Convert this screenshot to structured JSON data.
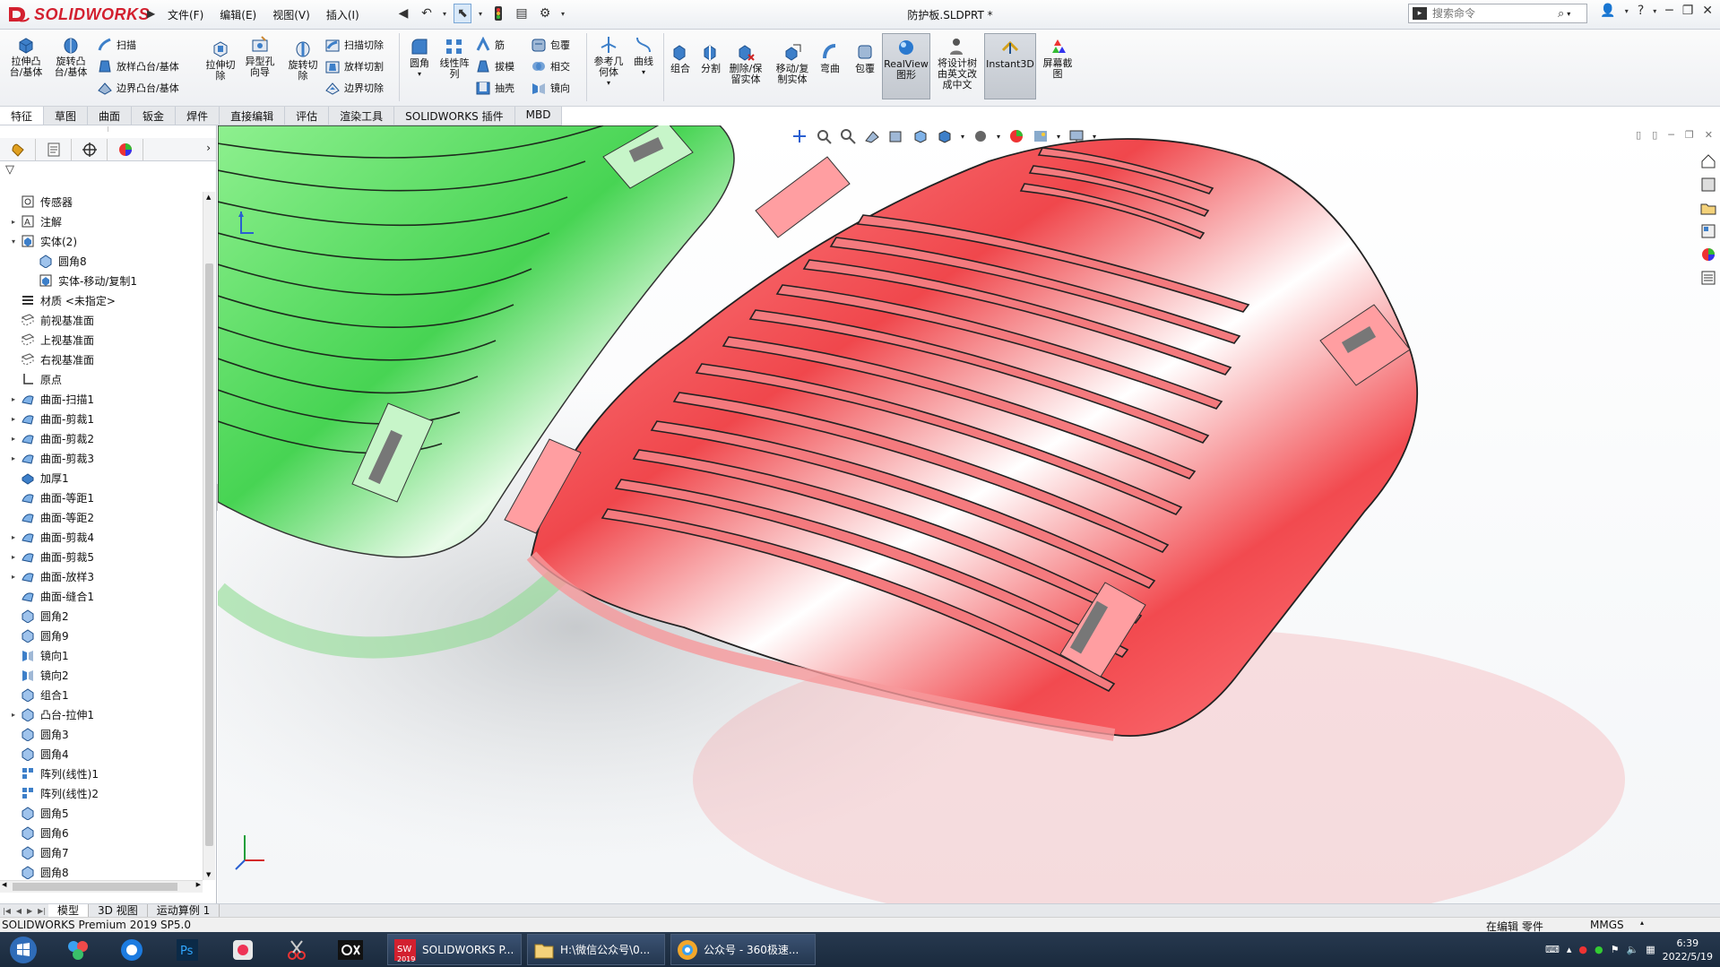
{
  "app": {
    "brand": "SOLIDWORKS",
    "document_title": "防护板.SLDPRT *"
  },
  "menu": [
    "文件(F)",
    "编辑(E)",
    "视图(V)",
    "插入(I)"
  ],
  "search": {
    "placeholder": "搜索命令"
  },
  "ribbon": {
    "extrude_boss": "拉伸凸\n台/基体",
    "revolve_boss": "旋转凸\n台/基体",
    "sweep": "扫描",
    "loft": "放样凸台/基体",
    "boundary_boss": "边界凸台/基体",
    "extrude_cut": "拉伸切\n除",
    "hole_wizard": "异型孔\n向导",
    "revolve_cut": "旋转切\n除",
    "swept_cut": "扫描切除",
    "lofted_cut": "放样切割",
    "boundary_cut": "边界切除",
    "fillet": "圆角",
    "linear_pattern": "线性阵\n列",
    "rib": "筋",
    "draft": "拔模",
    "shell": "抽壳",
    "wrap": "包覆",
    "intersect": "相交",
    "mirror": "镜向",
    "ref_geometry": "参考几\n何体",
    "curves": "曲线",
    "combine": "组合",
    "split": "分割",
    "delete_keep_body": "删除/保\n留实体",
    "move_copy_body": "移动/复\n制实体",
    "flex": "弯曲",
    "wrap2": "包覆",
    "realview": "RealView\n图形",
    "translate_tree": "将设计树\n由英文改\n成中文",
    "instant3d": "Instant3D",
    "screenshot": "屏幕截\n图"
  },
  "cmd_tabs": [
    "特征",
    "草图",
    "曲面",
    "钣金",
    "焊件",
    "直接编辑",
    "评估",
    "渲染工具",
    "SOLIDWORKS 插件",
    "MBD"
  ],
  "tree": [
    {
      "label": "传感器",
      "exp": "",
      "indent": 0
    },
    {
      "label": "注解",
      "exp": "▸",
      "indent": 0
    },
    {
      "label": "实体(2)",
      "exp": "▾",
      "indent": 0
    },
    {
      "label": "圆角8",
      "exp": "",
      "indent": 1
    },
    {
      "label": "实体-移动/复制1",
      "exp": "",
      "indent": 1
    },
    {
      "label": "材质 <未指定>",
      "exp": "",
      "indent": 0
    },
    {
      "label": "前视基准面",
      "exp": "",
      "indent": 0
    },
    {
      "label": "上视基准面",
      "exp": "",
      "indent": 0
    },
    {
      "label": "右视基准面",
      "exp": "",
      "indent": 0
    },
    {
      "label": "原点",
      "exp": "",
      "indent": 0
    },
    {
      "label": "曲面-扫描1",
      "exp": "▸",
      "indent": 0
    },
    {
      "label": "曲面-剪裁1",
      "exp": "▸",
      "indent": 0
    },
    {
      "label": "曲面-剪裁2",
      "exp": "▸",
      "indent": 0
    },
    {
      "label": "曲面-剪裁3",
      "exp": "▸",
      "indent": 0
    },
    {
      "label": "加厚1",
      "exp": "",
      "indent": 0
    },
    {
      "label": "曲面-等距1",
      "exp": "",
      "indent": 0
    },
    {
      "label": "曲面-等距2",
      "exp": "",
      "indent": 0
    },
    {
      "label": "曲面-剪裁4",
      "exp": "▸",
      "indent": 0
    },
    {
      "label": "曲面-剪裁5",
      "exp": "▸",
      "indent": 0
    },
    {
      "label": "曲面-放样3",
      "exp": "▸",
      "indent": 0
    },
    {
      "label": "曲面-缝合1",
      "exp": "",
      "indent": 0
    },
    {
      "label": "圆角2",
      "exp": "",
      "indent": 0
    },
    {
      "label": "圆角9",
      "exp": "",
      "indent": 0
    },
    {
      "label": "镜向1",
      "exp": "",
      "indent": 0
    },
    {
      "label": "镜向2",
      "exp": "",
      "indent": 0
    },
    {
      "label": "组合1",
      "exp": "",
      "indent": 0
    },
    {
      "label": "凸台-拉伸1",
      "exp": "▸",
      "indent": 0
    },
    {
      "label": "圆角3",
      "exp": "",
      "indent": 0
    },
    {
      "label": "圆角4",
      "exp": "",
      "indent": 0
    },
    {
      "label": "阵列(线性)1",
      "exp": "",
      "indent": 0
    },
    {
      "label": "阵列(线性)2",
      "exp": "",
      "indent": 0
    },
    {
      "label": "圆角5",
      "exp": "",
      "indent": 0
    },
    {
      "label": "圆角6",
      "exp": "",
      "indent": 0
    },
    {
      "label": "圆角7",
      "exp": "",
      "indent": 0
    },
    {
      "label": "圆角8",
      "exp": "",
      "indent": 0
    }
  ],
  "bottom_tabs": [
    "模型",
    "3D 视图",
    "运动算例 1"
  ],
  "status": {
    "product": "SOLIDWORKS Premium 2019 SP5.0",
    "mode": "在编辑 零件",
    "units": "MMGS"
  },
  "taskbar": {
    "sw_window": "SOLIDWORKS P...",
    "sw_badge": "2019",
    "folder_window": "H:\\微信公众号\\0...",
    "browser_window": "公众号 - 360极速...",
    "time": "6:39",
    "date": "2022/5/19"
  },
  "colors": {
    "brand_red": "#d3202f",
    "green_part": "#5ee06a",
    "red_part": "#f0474c"
  }
}
